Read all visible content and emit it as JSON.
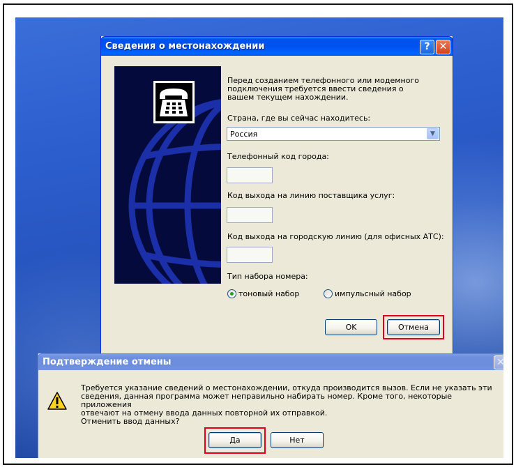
{
  "location_dialog": {
    "title": "Сведения о местонахождении",
    "help_button": "?",
    "close_button": "✕",
    "intro_text": "Перед созданием телефонного или модемного подключения требуется ввести сведения о вашем текущем нахождении.",
    "country_label": "Страна, где вы сейчас находитесь:",
    "country_value": "Россия",
    "area_code_label": "Телефонный код города:",
    "area_code_value": "",
    "carrier_code_label": "Код выхода на линию поставщика услуг:",
    "carrier_code_value": "",
    "outside_line_label": "Код выхода на городскую линию (для офисных АТС):",
    "outside_line_value": "",
    "dial_type_label": "Тип набора номера:",
    "dial_options": [
      {
        "label": "тоновый набор",
        "selected": true
      },
      {
        "label": "импульсный набор",
        "selected": false
      }
    ],
    "ok_button": "OK",
    "cancel_button": "Отмена"
  },
  "confirm_dialog": {
    "title": "Подтверждение отмены",
    "close_button": "✕",
    "message_lines": [
      "Требуется указание сведений о местонахождении, откуда производится вызов. Если не указать эти",
      "сведения, данная программа может неправильно набирать номер. Кроме того, некоторые приложения",
      "отвечают на отмену ввода данных повторной их отправкой.",
      "Отменить ввод данных?"
    ],
    "yes_button": "Да",
    "no_button": "Нет",
    "icon": "warning-icon"
  },
  "highlight_color": "#e3001b",
  "titlebar_color": "#0053ee"
}
